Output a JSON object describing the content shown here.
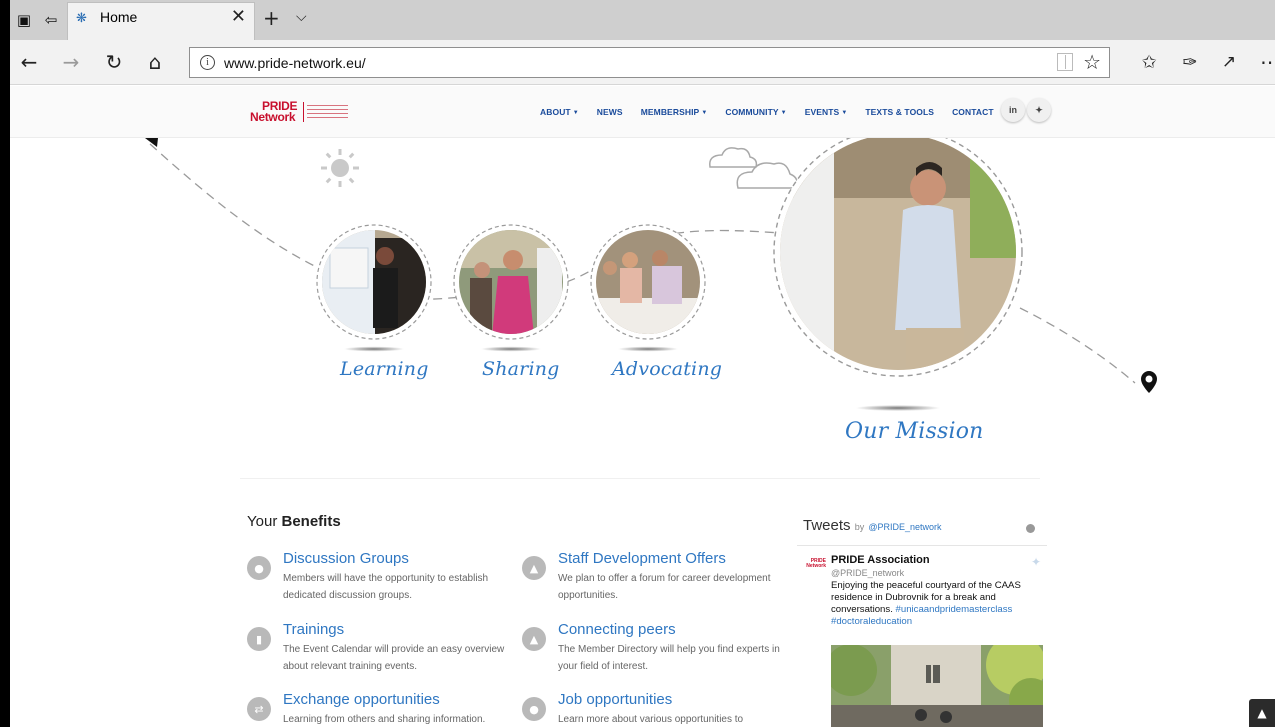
{
  "browser": {
    "tab_title": "Home",
    "url": "www.pride-network.eu/",
    "tab_close_glyph": "✕",
    "new_tab_glyph": "+",
    "tab_menu_glyph": "⌵"
  },
  "site": {
    "logo": {
      "line1": "PRIDE",
      "line2": "Network"
    },
    "nav": [
      {
        "label": "ABOUT",
        "dropdown": true
      },
      {
        "label": "NEWS",
        "dropdown": false
      },
      {
        "label": "MEMBERSHIP",
        "dropdown": true
      },
      {
        "label": "COMMUNITY",
        "dropdown": true
      },
      {
        "label": "EVENTS",
        "dropdown": true
      },
      {
        "label": "TEXTS & TOOLS",
        "dropdown": false
      },
      {
        "label": "CONTACT",
        "dropdown": false
      }
    ],
    "social": [
      {
        "name": "linkedin-icon",
        "glyph": "in"
      },
      {
        "name": "twitter-icon",
        "glyph": "✦"
      }
    ]
  },
  "hero": {
    "circles": [
      {
        "label": "Learning"
      },
      {
        "label": "Sharing"
      },
      {
        "label": "Advocating"
      },
      {
        "label": "Our Mission"
      }
    ]
  },
  "benefits": {
    "title_prefix": "Your",
    "title_bold": "Benefits",
    "items": [
      {
        "title": "Discussion Groups",
        "text": "Members will have the opportunity to establish dedicated discussion groups.",
        "icon": "chat-icon"
      },
      {
        "title": "Staff Development Offers",
        "text": "We plan to offer a forum for career development opportunities.",
        "icon": "trophy-icon"
      },
      {
        "title": "Trainings",
        "text": "The Event Calendar will provide an easy overview about relevant training events.",
        "icon": "document-icon"
      },
      {
        "title": "Connecting peers",
        "text": "The Member Directory will help you find experts in your field of interest.",
        "icon": "person-icon"
      },
      {
        "title": "Exchange opportunities",
        "text": "Learning from others and sharing information.",
        "icon": "exchange-icon"
      },
      {
        "title": "Job opportunities",
        "text": "Learn more about various opportunities to",
        "icon": "group-icon"
      }
    ]
  },
  "tweets": {
    "heading": "Tweets",
    "by": "by",
    "handle": "@PRIDE_network",
    "tweet": {
      "name": "PRIDE Association",
      "screen_name": "@PRIDE_network",
      "text": "Enjoying the peaceful courtyard of the CAAS residence in Dubrovnik for a break and conversations.",
      "hashtags": "#unicaandpridemasterclass #doctoraleducation",
      "avatar_line1": "PRIDE",
      "avatar_line2": "Network"
    }
  },
  "colors": {
    "brand_red": "#c8102e",
    "nav_blue": "#1a4b9b",
    "link_blue": "#2f77c2"
  }
}
